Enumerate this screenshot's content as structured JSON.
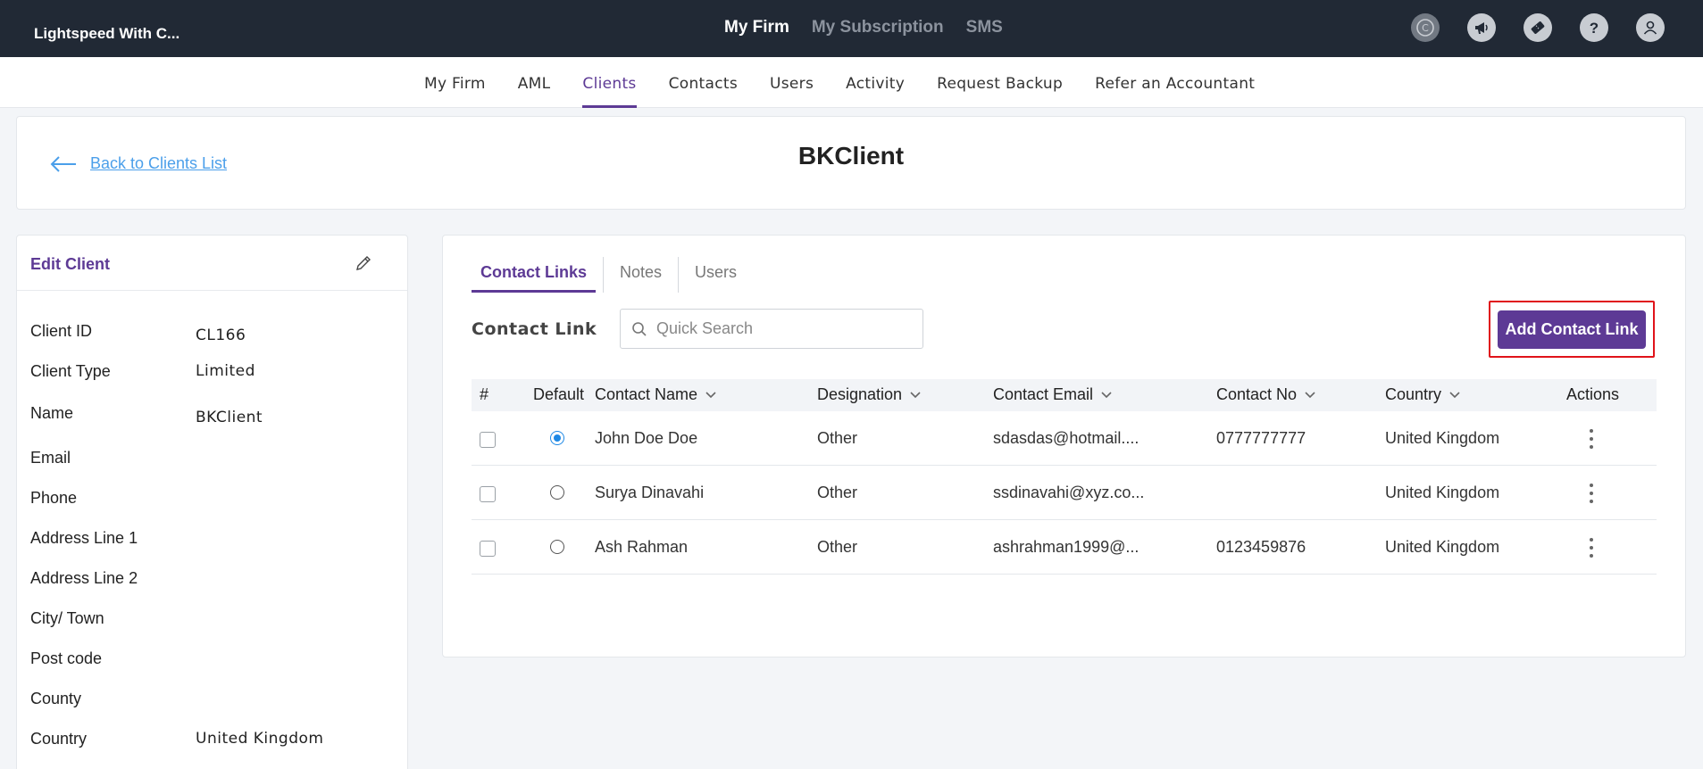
{
  "topbar": {
    "firm_name": "Lightspeed With C...",
    "nav": [
      "My Firm",
      "My Subscription",
      "SMS"
    ],
    "icons": [
      "coin-icon",
      "megaphone-icon",
      "ticket-icon",
      "help-icon",
      "user-icon"
    ]
  },
  "subnav": {
    "items": [
      "My Firm",
      "AML",
      "Clients",
      "Contacts",
      "Users",
      "Activity",
      "Request Backup",
      "Refer an Accountant"
    ],
    "active": "Clients"
  },
  "header": {
    "back_label": "Back to Clients List",
    "title": "BKClient"
  },
  "client_panel": {
    "title": "Edit Client",
    "fields": [
      {
        "label": "Client ID",
        "value": "CL166"
      },
      {
        "label": "Client Type",
        "value": "Limited"
      },
      {
        "label": "Name",
        "value": "BKClient"
      },
      {
        "label": "Email",
        "value": ""
      },
      {
        "label": "Phone",
        "value": ""
      },
      {
        "label": "Address Line 1",
        "value": ""
      },
      {
        "label": "Address Line 2",
        "value": ""
      },
      {
        "label": "City/ Town",
        "value": ""
      },
      {
        "label": "Post code",
        "value": ""
      },
      {
        "label": "County",
        "value": ""
      },
      {
        "label": "Country",
        "value": "United Kingdom"
      }
    ]
  },
  "tabs": [
    "Contact Links",
    "Notes",
    "Users"
  ],
  "contact_link": {
    "section_title": "Contact Link",
    "search_placeholder": "Quick Search",
    "add_button": "Add Contact Link",
    "columns": [
      "#",
      "Default",
      "Contact Name",
      "Designation",
      "Contact Email",
      "Contact No",
      "Country",
      "Actions"
    ],
    "rows": [
      {
        "default": true,
        "name": "John Doe Doe",
        "designation": "Other",
        "email": "sdasdas@hotmail....",
        "phone": "0777777777",
        "country": "United Kingdom"
      },
      {
        "default": false,
        "name": "Surya Dinavahi",
        "designation": "Other",
        "email": "ssdinavahi@xyz.co...",
        "phone": "",
        "country": "United Kingdom"
      },
      {
        "default": false,
        "name": "Ash Rahman",
        "designation": "Other",
        "email": "ashrahman1999@...",
        "phone": "0123459876",
        "country": "United Kingdom"
      }
    ]
  },
  "colors": {
    "topbar_bg": "#212935",
    "accent": "#5d3a95",
    "link": "#4b9fea",
    "highlight_border": "#e0131a"
  }
}
